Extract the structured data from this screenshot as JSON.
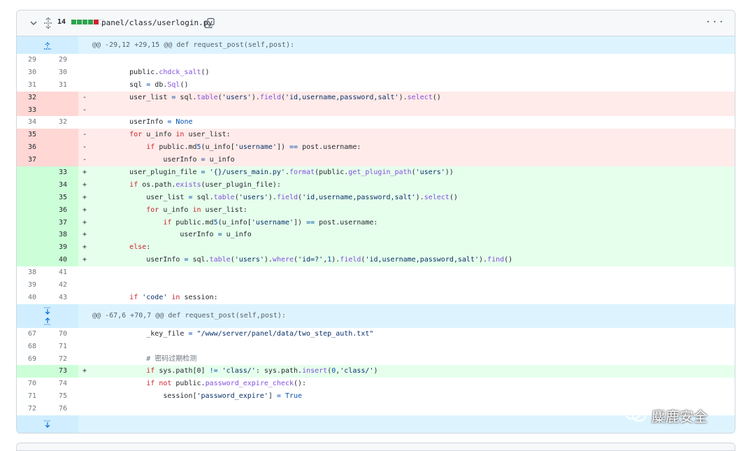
{
  "file_header": {
    "change_count": "14",
    "path": "panel/class/userlogin.py",
    "more_label": "···",
    "diffstat_colors": [
      "#2da44e",
      "#2da44e",
      "#2da44e",
      "#2da44e",
      "#cf222e",
      "#ffffff"
    ]
  },
  "rows": [
    {
      "type": "hunk",
      "text": "@@ -29,12 +29,15 @@ def request_post(self,post):"
    },
    {
      "type": "ctx",
      "old": "29",
      "new": "29",
      "code": ""
    },
    {
      "type": "ctx",
      "old": "30",
      "new": "30",
      "code": "        public.chdck_salt()"
    },
    {
      "type": "ctx",
      "old": "31",
      "new": "31",
      "code": "        sql = db.Sql()"
    },
    {
      "type": "del",
      "old": "32",
      "new": "",
      "code": "        user_list = sql.table('users').field('id,username,password,salt').select()"
    },
    {
      "type": "del",
      "old": "33",
      "new": "",
      "code": ""
    },
    {
      "type": "ctx",
      "old": "34",
      "new": "32",
      "code": "        userInfo = None"
    },
    {
      "type": "del",
      "old": "35",
      "new": "",
      "code": "        for u_info in user_list:"
    },
    {
      "type": "del",
      "old": "36",
      "new": "",
      "code": "            if public.md5(u_info['username']) == post.username:"
    },
    {
      "type": "del",
      "old": "37",
      "new": "",
      "code": "                userInfo = u_info"
    },
    {
      "type": "add",
      "old": "",
      "new": "33",
      "code": "        user_plugin_file = '{}/users_main.py'.format(public.get_plugin_path('users'))"
    },
    {
      "type": "add",
      "old": "",
      "new": "34",
      "code": "        if os.path.exists(user_plugin_file):"
    },
    {
      "type": "add",
      "old": "",
      "new": "35",
      "code": "            user_list = sql.table('users').field('id,username,password,salt').select()"
    },
    {
      "type": "add",
      "old": "",
      "new": "36",
      "code": "            for u_info in user_list:"
    },
    {
      "type": "add",
      "old": "",
      "new": "37",
      "code": "                if public.md5(u_info['username']) == post.username:"
    },
    {
      "type": "add",
      "old": "",
      "new": "38",
      "code": "                    userInfo = u_info"
    },
    {
      "type": "add",
      "old": "",
      "new": "39",
      "code": "        else:"
    },
    {
      "type": "add",
      "old": "",
      "new": "40",
      "code": "            userInfo = sql.table('users').where('id=?',1).field('id,username,password,salt').find()"
    },
    {
      "type": "ctx",
      "old": "38",
      "new": "41",
      "code": ""
    },
    {
      "type": "ctx",
      "old": "39",
      "new": "42",
      "code": ""
    },
    {
      "type": "ctx",
      "old": "40",
      "new": "43",
      "code": "        if 'code' in session:"
    },
    {
      "type": "hunk2",
      "text": "@@ -67,6 +70,7 @@ def request_post(self,post):"
    },
    {
      "type": "ctx",
      "old": "67",
      "new": "70",
      "code": "            _key_file = \"/www/server/panel/data/two_step_auth.txt\""
    },
    {
      "type": "ctx",
      "old": "68",
      "new": "71",
      "code": ""
    },
    {
      "type": "ctx",
      "old": "69",
      "new": "72",
      "code": "            # 密码过期检测"
    },
    {
      "type": "add",
      "old": "",
      "new": "73",
      "code": "            if sys.path[0] != 'class/': sys.path.insert(0,'class/')"
    },
    {
      "type": "ctx",
      "old": "70",
      "new": "74",
      "code": "            if not public.password_expire_check():"
    },
    {
      "type": "ctx",
      "old": "71",
      "new": "75",
      "code": "                session['password_expire'] = True"
    },
    {
      "type": "ctx",
      "old": "72",
      "new": "76",
      "code": ""
    },
    {
      "type": "hunk3",
      "text": ""
    }
  ],
  "watermark": {
    "text": "麋鹿安全"
  }
}
